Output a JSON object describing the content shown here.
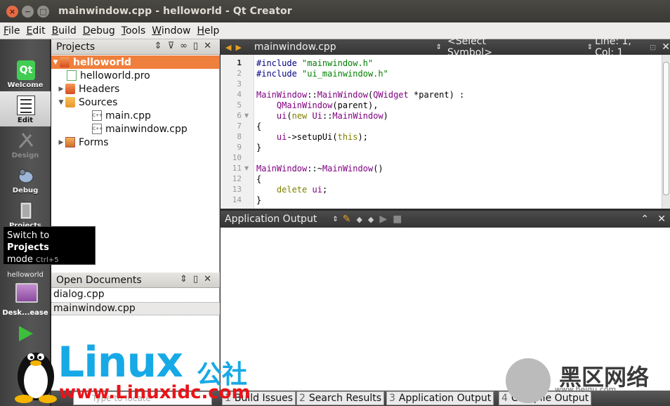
{
  "window": {
    "title": "mainwindow.cpp - helloworld - Qt Creator",
    "close_glyph": "×",
    "min_glyph": "−",
    "max_glyph": "□"
  },
  "menu": [
    "File",
    "Edit",
    "Build",
    "Debug",
    "Tools",
    "Window",
    "Help"
  ],
  "modes": {
    "welcome": "Welcome",
    "edit": "Edit",
    "design": "Design",
    "debug": "Debug",
    "projects": "Projects",
    "qt_logo": "Qt"
  },
  "tooltip": {
    "prefix": "Switch to ",
    "bold": "Projects",
    "line2": "mode",
    "shortcut": "Ctrl+5"
  },
  "kit": {
    "project": "helloworld",
    "name": "Desk...ease"
  },
  "projects_pane": {
    "title": "Projects",
    "tree": [
      {
        "label": "helloworld"
      },
      {
        "label": "helloworld.pro"
      },
      {
        "label": "Headers"
      },
      {
        "label": "Sources"
      },
      {
        "label": "main.cpp"
      },
      {
        "label": "mainwindow.cpp"
      },
      {
        "label": "Forms"
      }
    ]
  },
  "open_documents": {
    "title": "Open Documents",
    "items": [
      "dialog.cpp",
      "mainwindow.cpp"
    ]
  },
  "editor": {
    "file": "mainwindow.cpp",
    "symbol": "<Select Symbol>",
    "position": "Line: 1, Col: 1",
    "line_numbers": [
      "1",
      "2",
      "3",
      "4",
      "5",
      "6",
      "7",
      "8",
      "9",
      "10",
      "11",
      "12",
      "13",
      "14"
    ],
    "lines": [
      "#include \"mainwindow.h\"",
      "#include \"ui_mainwindow.h\"",
      "",
      "MainWindow::MainWindow(QWidget *parent) :",
      "    QMainWindow(parent),",
      "    ui(new Ui::MainWindow)",
      "{",
      "    ui->setupUi(this);",
      "}",
      "",
      "MainWindow::~MainWindow()",
      "{",
      "    delete ui;",
      "}"
    ]
  },
  "output": {
    "title": "Application Output"
  },
  "bottom": {
    "locator_placeholder": "Type to locate",
    "tabs": [
      {
        "num": "1",
        "label": "Build Issues"
      },
      {
        "num": "2",
        "label": "Search Results"
      },
      {
        "num": "3",
        "label": "Application Output"
      },
      {
        "num": "4",
        "label": "Compile Output"
      }
    ]
  },
  "watermarks": {
    "linux": "Linux",
    "linux_cn": "公社",
    "url": "www.Linuxidc.com",
    "hei": "黑区网络",
    "hei_url": "www.heiqu.com"
  }
}
